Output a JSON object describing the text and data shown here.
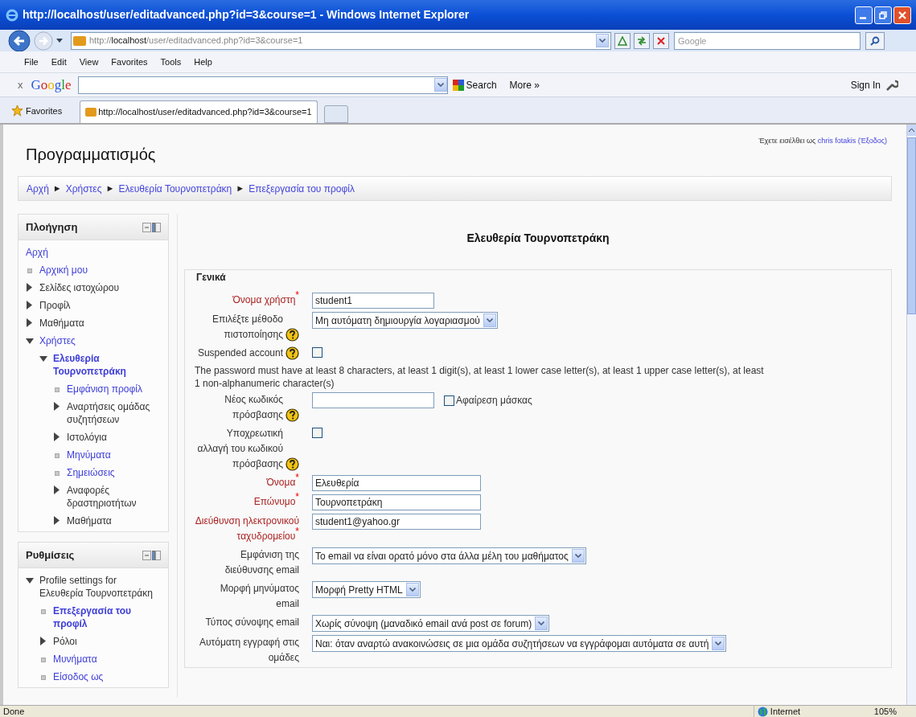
{
  "window": {
    "title": "http://localhost/user/editadvanced.php?id=3&course=1 - Windows Internet Explorer"
  },
  "address_bar": {
    "url_prefix": "http://",
    "url_host": "localhost",
    "url_path": "/user/editadvanced.php?id=3&course=1",
    "search_placeholder": "Google"
  },
  "menu": [
    "File",
    "Edit",
    "View",
    "Favorites",
    "Tools",
    "Help"
  ],
  "google_toolbar": {
    "close": "x",
    "logo": "Google",
    "search": "Search",
    "more": "More »",
    "sign_in": "Sign In"
  },
  "favorites_bar": {
    "favorites": "Favorites",
    "tab": "http://localhost/user/editadvanced.php?id=3&course=1"
  },
  "page": {
    "site_title": "Προγραμματισμός",
    "login": {
      "prefix": "Έχετε εισέλθει ως",
      "user": "chris fotakis",
      "logout": "(Έξοδος)"
    },
    "breadcrumb": {
      "separator": "►",
      "items": [
        "Αρχή",
        "Χρήστες",
        "Ελευθερία Τουρνοπετράκη",
        "Επεξεργασία του προφίλ"
      ]
    },
    "blocks": [
      {
        "title": "Πλοήγηση",
        "items": [
          {
            "label": "Αρχή",
            "kind": "plain",
            "link": true,
            "active": false
          },
          {
            "label": "Αρχική μου",
            "kind": "leaf",
            "link": true,
            "active": false
          },
          {
            "label": "Σελίδες ιστοχώρου",
            "kind": "branch",
            "expanded": false,
            "link": false,
            "active": false
          },
          {
            "label": "Προφίλ",
            "kind": "branch",
            "expanded": false,
            "link": false,
            "active": false
          },
          {
            "label": "Μαθήματα",
            "kind": "branch",
            "expanded": false,
            "link": false,
            "active": false
          },
          {
            "label": "Χρήστες",
            "kind": "branch",
            "expanded": true,
            "link": true,
            "active": false,
            "children": [
              {
                "label": "Ελευθερία Τουρνοπετράκη",
                "kind": "branch",
                "expanded": true,
                "link": true,
                "active": true,
                "children": [
                  {
                    "label": "Εμφάνιση προφίλ",
                    "kind": "leaf",
                    "link": true,
                    "active": false
                  },
                  {
                    "label": "Αναρτήσεις ομάδας συζητήσεων",
                    "kind": "branch",
                    "expanded": false,
                    "link": false,
                    "active": false
                  },
                  {
                    "label": "Ιστολόγια",
                    "kind": "branch",
                    "expanded": false,
                    "link": false,
                    "active": false
                  },
                  {
                    "label": "Μηνύματα",
                    "kind": "leaf",
                    "link": true,
                    "active": false
                  },
                  {
                    "label": "Σημειώσεις",
                    "kind": "leaf",
                    "link": true,
                    "active": false
                  },
                  {
                    "label": "Αναφορές δραστηριοτήτων",
                    "kind": "branch",
                    "expanded": false,
                    "link": false,
                    "active": false
                  },
                  {
                    "label": "Μαθήματα",
                    "kind": "branch",
                    "expanded": false,
                    "link": false,
                    "active": false
                  }
                ]
              }
            ]
          }
        ]
      },
      {
        "title": "Ρυθμίσεις",
        "items": [
          {
            "label": "Profile settings for Ελευθερία Τουρνοπετράκη",
            "kind": "branch",
            "expanded": true,
            "link": false,
            "active": false,
            "children": [
              {
                "label": "Επεξεργασία του προφίλ",
                "kind": "leaf",
                "link": true,
                "active": true
              },
              {
                "label": "Ρόλοι",
                "kind": "branch",
                "expanded": false,
                "link": false,
                "active": false
              },
              {
                "label": "Μυνήματα",
                "kind": "leaf",
                "link": true,
                "active": false
              },
              {
                "label": "Είσοδος ως",
                "kind": "leaf",
                "link": true,
                "active": false
              }
            ]
          }
        ]
      }
    ],
    "form_title": "Ελευθερία Τουρνοπετράκη",
    "fieldset": {
      "legend": "Γενικά",
      "required_mark": "*",
      "rows": [
        {
          "kind": "text",
          "label": "Όνομα χρήστη",
          "required": true,
          "help": false,
          "value": "student1"
        },
        {
          "kind": "select",
          "label": "Επιλέξτε μέθοδο πιστοποίησης",
          "required": false,
          "help": true,
          "value": "Μη αυτόματη δημιουργία λογαριασμού"
        },
        {
          "kind": "checkbox",
          "label": "Suspended account",
          "required": false,
          "help": true,
          "checked": false
        },
        {
          "kind": "note",
          "text": "The password must have at least 8 characters, at least 1 digit(s), at least 1 lower case letter(s), at least 1 upper case letter(s), at least 1 non-alphanumeric character(s)"
        },
        {
          "kind": "password",
          "label": "Νέος κωδικός πρόσβασης",
          "required": false,
          "help": true,
          "unmask": {
            "label": "Αφαίρεση μάσκας",
            "checked": false
          }
        },
        {
          "kind": "checkbox",
          "label": "Υποχρεωτική αλλαγή του κωδικού πρόσβασης",
          "required": false,
          "help": true,
          "checked": false
        },
        {
          "kind": "text",
          "label": "Όνομα",
          "required": true,
          "help": false,
          "value": "Ελευθερία"
        },
        {
          "kind": "text",
          "label": "Επώνυμο",
          "required": true,
          "help": false,
          "value": "Τουρνοπετράκη"
        },
        {
          "kind": "text",
          "label": "Διεύθυνση ηλεκτρονικού ταχυδρομείου",
          "required": true,
          "help": false,
          "value": "student1@yahoo.gr"
        },
        {
          "kind": "select",
          "label": "Εμφάνιση της διεύθυνσης email",
          "required": false,
          "help": false,
          "value": "Το email να είναι ορατό μόνο στα άλλα μέλη του μαθήματος"
        },
        {
          "kind": "select",
          "label": "Μορφή μηνύματος email",
          "required": false,
          "help": false,
          "value": "Μορφή Pretty HTML"
        },
        {
          "kind": "select",
          "label": "Τύπος σύνοψης email",
          "required": false,
          "help": false,
          "value": "Χωρίς σύνοψη (μαναδικό email ανά post σε forum)"
        },
        {
          "kind": "select",
          "label": "Αυτόματη εγγραφή στις ομάδες",
          "required": false,
          "help": false,
          "value": "Ναι: όταν αναρτώ ανακοινώσεις σε μια ομάδα συζητήσεων να εγγράφομαι αυτόματα σε αυτή"
        }
      ]
    }
  },
  "status_bar": {
    "text": "Done",
    "zone": "Internet",
    "zoom": "105%"
  }
}
